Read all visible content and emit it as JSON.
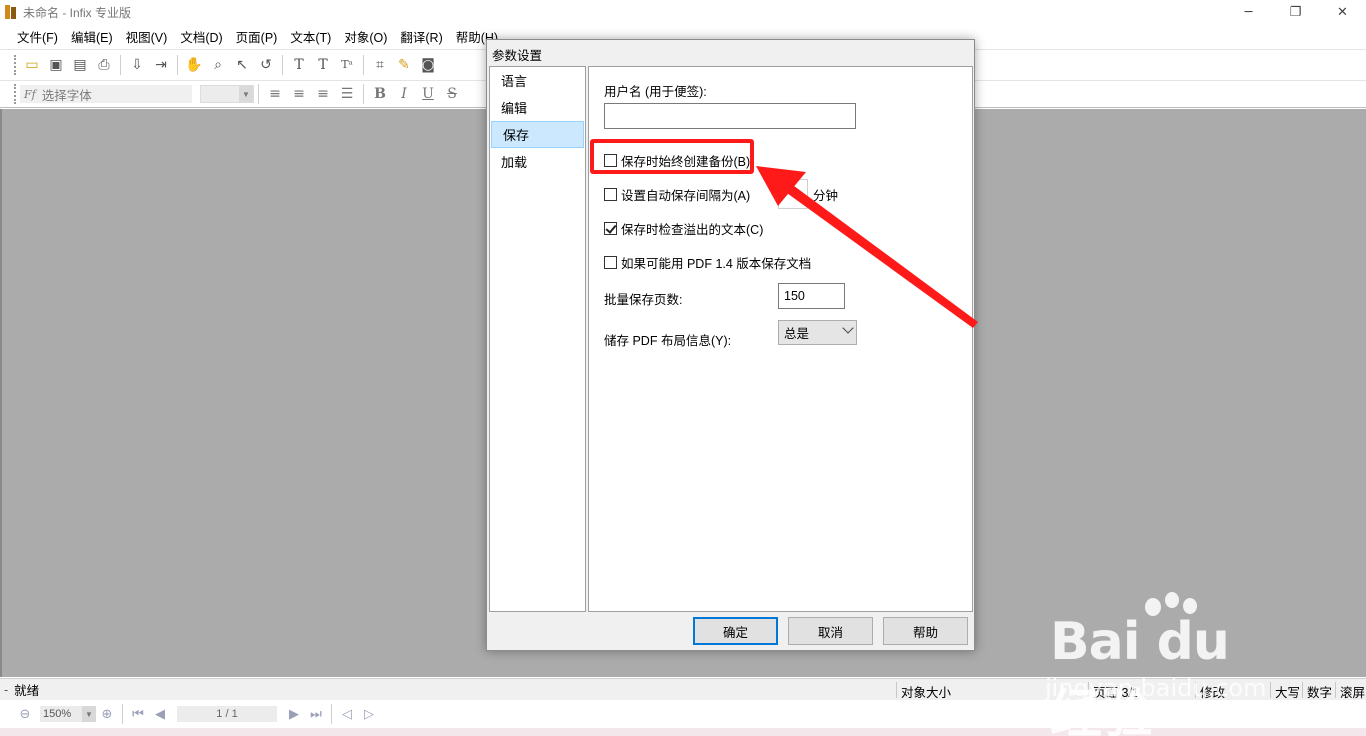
{
  "window": {
    "title": "未命名 - Infix 专业版",
    "controls": [
      "─",
      "❐",
      "✕"
    ]
  },
  "menu": [
    "文件(F)",
    "编辑(E)",
    "视图(V)",
    "文档(D)",
    "页面(P)",
    "文本(T)",
    "对象(O)",
    "翻译(R)",
    "帮助(H)"
  ],
  "toolbar": {
    "font_placeholder": "选择字体",
    "font_prefix": "Ff"
  },
  "dialog": {
    "title": "参数设置",
    "categories": [
      "语言",
      "编辑",
      "保存",
      "加载"
    ],
    "selected_category": "保存",
    "username_label": "用户名 (用于便签):",
    "username_value": "",
    "backup_label": "保存时始终创建备份(B)",
    "backup_checked": false,
    "autosave_label": "设置自动保存间隔为(A)",
    "autosave_checked": false,
    "autosave_unit": "分钟",
    "overflow_label": "保存时检查溢出的文本(C)",
    "overflow_checked": true,
    "pdf14_label": "如果可能用 PDF 1.4 版本保存文档",
    "pdf14_checked": false,
    "batch_label": "批量保存页数:",
    "batch_value": "150",
    "layout_label": "储存 PDF 布局信息(Y):",
    "layout_value": "总是",
    "ok": "确定",
    "cancel": "取消",
    "help": "帮助"
  },
  "status": {
    "ready": "就绪",
    "object_size": "对象大小",
    "page": "页面 3/1",
    "mod": "修改",
    "caps": "大写",
    "num": "数字",
    "scroll": "滚屏"
  },
  "nav": {
    "zoom": "150%",
    "page": "1 / 1"
  },
  "watermark": {
    "brand": "Bai du 经验",
    "url": "jingyan.baidu.com"
  },
  "colors": {
    "highlight": "#ff1a1a",
    "workspace": "#ababab",
    "selection": "#cce8ff"
  }
}
